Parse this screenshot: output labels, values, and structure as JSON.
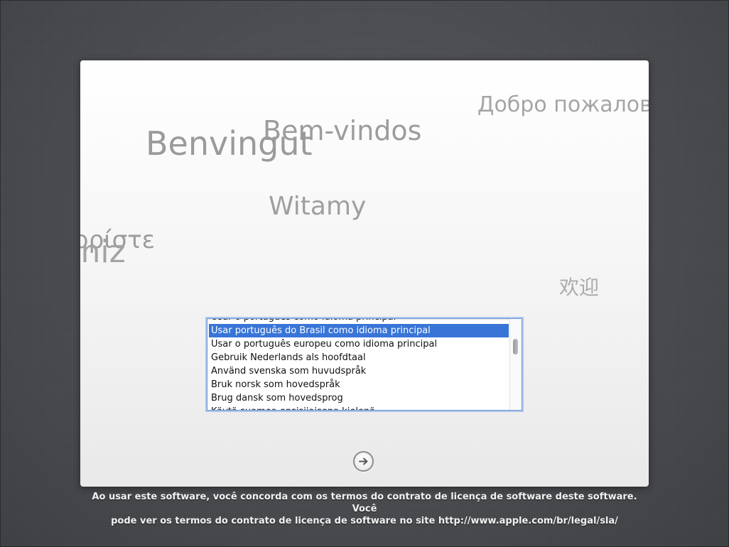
{
  "greetings": {
    "russian": "Добро пожалов",
    "portuguese": "Bem-vindos",
    "catalan": "Benvingut",
    "polish": "Witamy",
    "greek": "ς ορίστε",
    "turkish": "ş Geldiniz",
    "chinese": "欢迎"
  },
  "language_list": {
    "items": [
      "Usar o português como idioma principal",
      "Usar português do Brasil como idioma principal",
      "Usar o português europeu como idioma principal",
      "Gebruik Nederlands als hoofdtaal",
      "Använd svenska som huvudspråk",
      "Bruk norsk som hovedspråk",
      "Brug dansk som hovedsprog",
      "Käytä suomea ensisijaisena kielenä"
    ],
    "selected": "Usar português do Brasil como idioma principal"
  },
  "continue_button": {
    "icon": "arrow-right-icon"
  },
  "license": {
    "line1": "Ao usar este software, você concorda com os termos do contrato de licença de software deste software. Você",
    "line2": "pode ver os termos do contrato de licença de software no site http://www.apple.com/br/legal/sla/"
  },
  "colors": {
    "selection": "#3875d7",
    "focus_ring": "#6f9ad6",
    "background": "#4a4c50"
  }
}
